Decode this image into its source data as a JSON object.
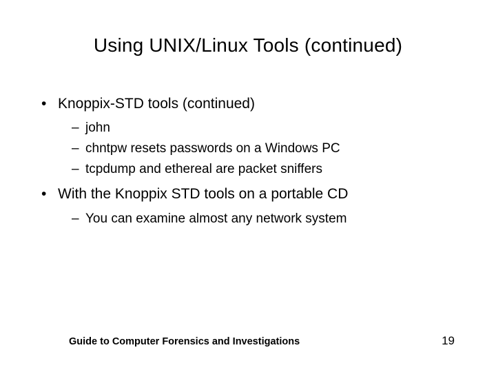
{
  "title": "Using UNIX/Linux Tools (continued)",
  "bullets": [
    {
      "text": "Knoppix-STD tools (continued)",
      "children": [
        {
          "text": "john"
        },
        {
          "text": "chntpw resets passwords on a Windows PC"
        },
        {
          "text": "tcpdump and ethereal are packet sniffers"
        }
      ]
    },
    {
      "text": "With the Knoppix STD tools on a portable CD",
      "children": [
        {
          "text": "You can examine almost any network system"
        }
      ]
    }
  ],
  "footer": {
    "text": "Guide to Computer Forensics and Investigations",
    "page": "19"
  }
}
